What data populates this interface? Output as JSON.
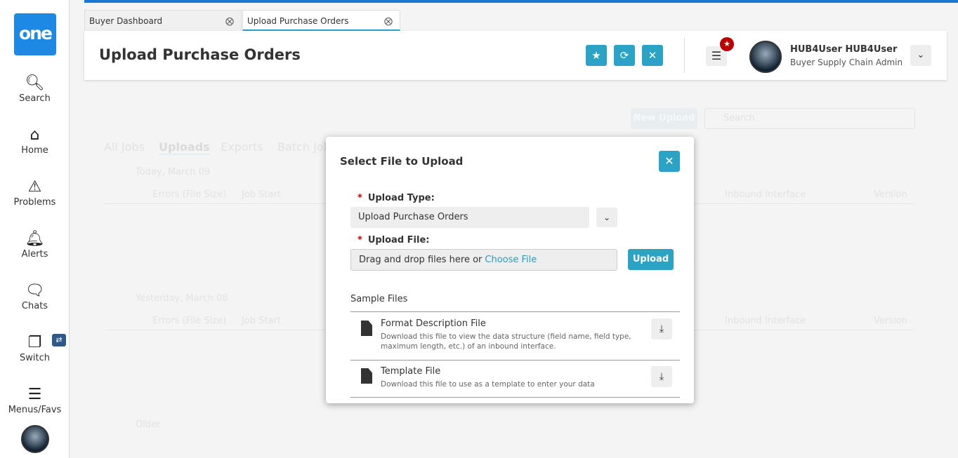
{
  "sidebar": {
    "logo": "one",
    "items": [
      {
        "label": "Search"
      },
      {
        "label": "Home"
      },
      {
        "label": "Problems"
      },
      {
        "label": "Alerts"
      },
      {
        "label": "Chats"
      },
      {
        "label": "Switch"
      },
      {
        "label": "Menus/Favs"
      }
    ]
  },
  "tabs": [
    {
      "label": "Buyer Dashboard"
    },
    {
      "label": "Upload Purchase Orders"
    }
  ],
  "header": {
    "title": "Upload Purchase Orders",
    "user_name": "HUB4User HUB4User",
    "user_role": "Buyer Supply Chain Admin"
  },
  "background": {
    "new_upload": "New Upload",
    "search_placeholder": "Search",
    "tabs": [
      "All Jobs",
      "Uploads",
      "Exports",
      "Batch Jobs"
    ],
    "groups": [
      "Today, March 09",
      "Yesterday, March 08",
      "Older"
    ],
    "columns": [
      "Errors (File Size)",
      "Job Start",
      "Inbound Interface",
      "Version"
    ]
  },
  "modal": {
    "title": "Select File to Upload",
    "upload_type_label": "Upload Type:",
    "upload_type_value": "Upload Purchase Orders",
    "upload_file_label": "Upload File:",
    "drop_text": "Drag and drop files here or",
    "choose_file": "Choose File",
    "upload_button": "Upload",
    "sample_files": "Sample Files",
    "files": [
      {
        "name": "Format Description File",
        "desc": "Download this file to view the data structure (field name, field type, maximum length, etc.) of an inbound interface."
      },
      {
        "name": "Template File",
        "desc": "Download this file to use as a template to enter your data"
      }
    ]
  }
}
